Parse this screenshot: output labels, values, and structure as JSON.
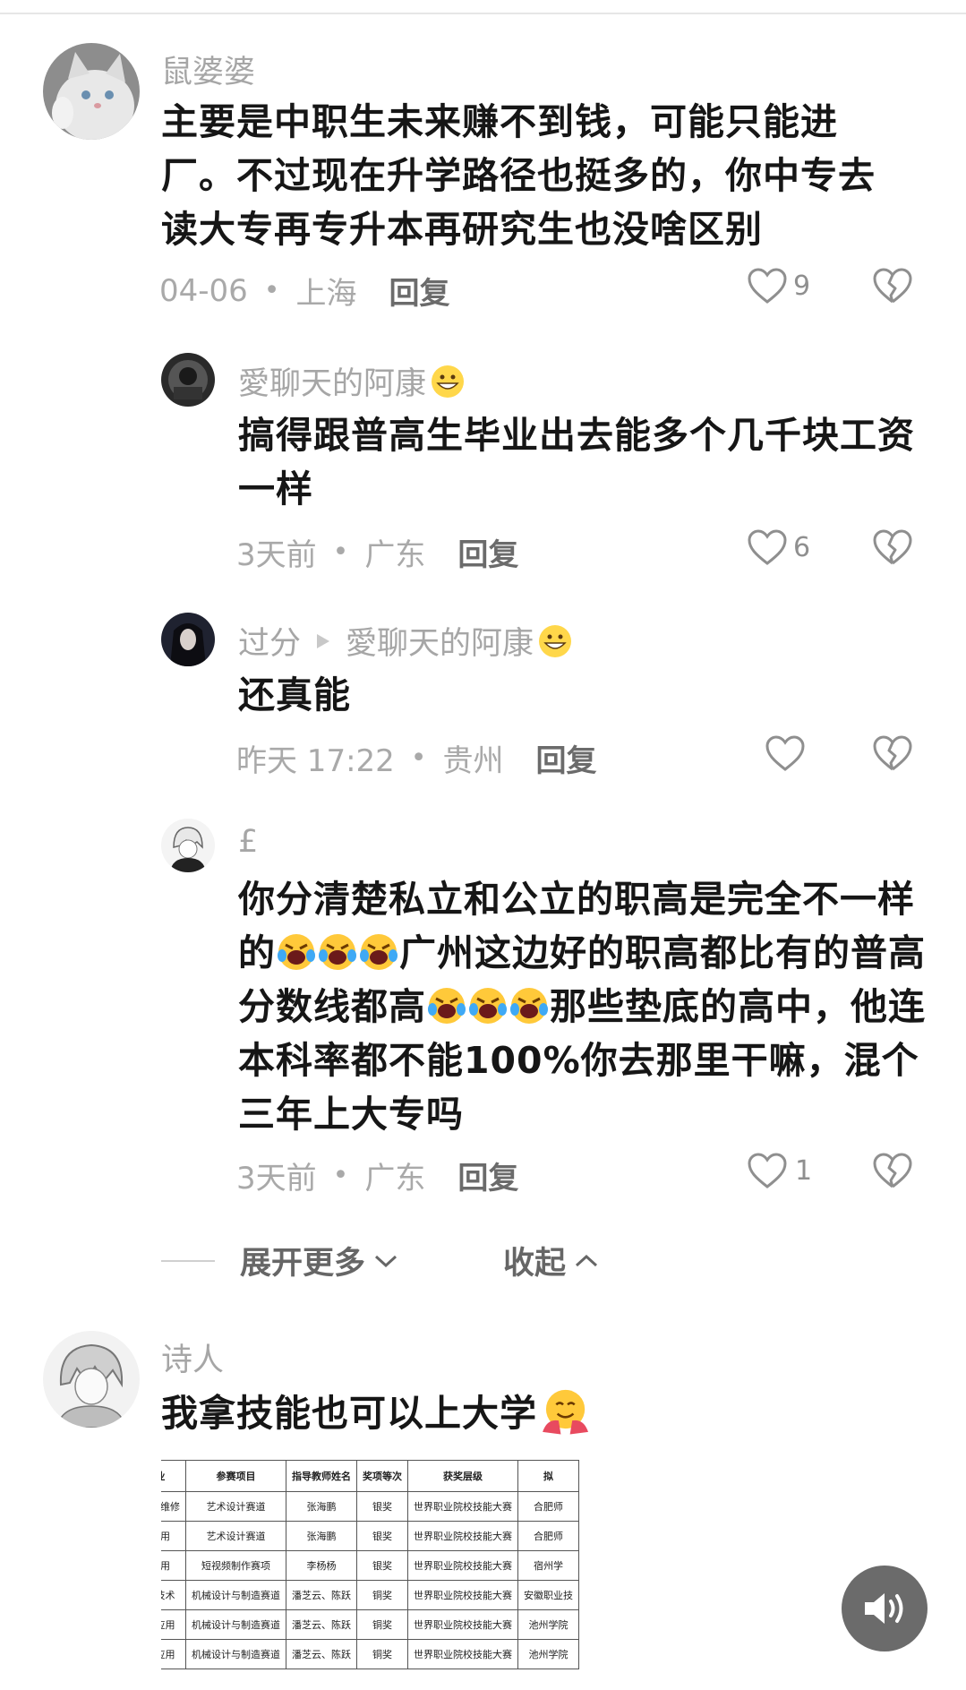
{
  "comments": [
    {
      "user": "鼠婆婆",
      "text": "主要是中职生未来赚不到钱，可能只能进厂。不过现在升学路径也挺多的，你中专去读大专再专升本再研究生也没啥区别",
      "date": "04-06",
      "location": "上海",
      "reply": "回复",
      "likes": "9"
    },
    {
      "user": "愛聊天的阿康",
      "text": "搞得跟普高生毕业出去能多个几千块工资一样",
      "date": "3天前",
      "location": "广东",
      "reply": "回复",
      "likes": "6"
    },
    {
      "user": "过分",
      "reply_to": "愛聊天的阿康",
      "text": "还真能",
      "date": "昨天 17:22",
      "location": "贵州",
      "reply": "回复",
      "likes": ""
    },
    {
      "user": "£",
      "text_parts": [
        "你分清楚私立和公立的职高是完全不一样的",
        "广州这边好的职高都比有的普高分数线都高",
        "那些垫底的高中，他连本科率都不能100%你去那里干嘛，混个三年上大专吗"
      ],
      "date": "3天前",
      "location": "广东",
      "reply": "回复",
      "likes": "1"
    },
    {
      "user": "诗人",
      "text": "我拿技能也可以上大学"
    }
  ],
  "expand_label": "展开更多",
  "collapse_label": "收起",
  "award_table": {
    "headers": [
      "业",
      "参赛项目",
      "指导教师姓名",
      "奖项等次",
      "获奖层级",
      "拟"
    ],
    "rows": [
      [
        "用与维修",
        "艺术设计赛道",
        "张海鹏",
        "银奖",
        "世界职业院校技能大赛",
        "合肥师"
      ],
      [
        "应用",
        "艺术设计赛道",
        "张海鹏",
        "银奖",
        "世界职业院校技能大赛",
        "合肥师"
      ],
      [
        "应用",
        "短视频制作赛项",
        "李杨杨",
        "银奖",
        "世界职业院校技能大赛",
        "宿州学"
      ],
      [
        "造技术",
        "机械设计与制造赛道",
        "潘芝云、陈跃",
        "铜奖",
        "世界职业院校技能大赛",
        "安徽职业技"
      ],
      [
        "术应用",
        "机械设计与制造赛道",
        "潘芝云、陈跃",
        "铜奖",
        "世界职业院校技能大赛",
        "池州学院"
      ],
      [
        "术应用",
        "机械设计与制造赛道",
        "潘芝云、陈跃",
        "铜奖",
        "世界职业院校技能大赛",
        "池州学院"
      ]
    ]
  },
  "colors": {
    "text": "#161616",
    "meta": "#a9a9a9",
    "icon": "#8f8f8f",
    "sound_bg": "#6b6b6b"
  }
}
